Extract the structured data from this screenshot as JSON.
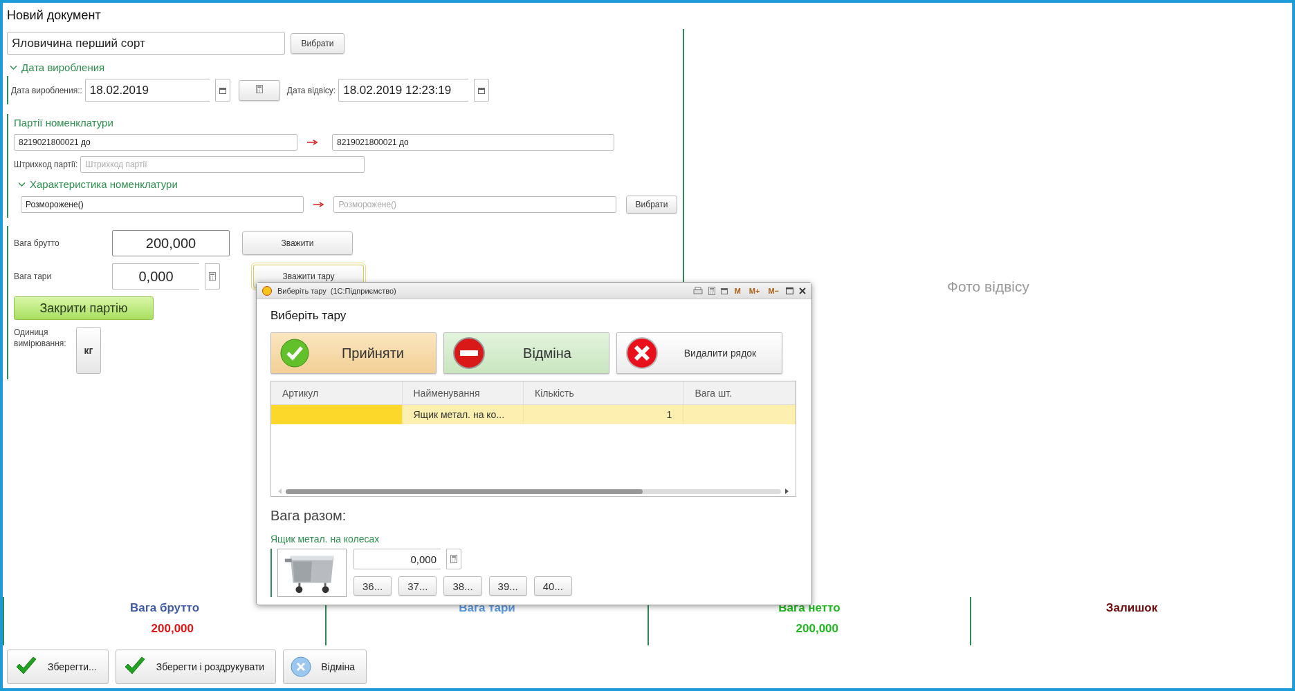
{
  "window": {
    "title": "Новий документ"
  },
  "product": {
    "value": "Яловичина перший сорт",
    "button": "Вибрати"
  },
  "production": {
    "title": "Дата виробления",
    "expanded": true,
    "production_date": {
      "label": "Дата виробления::",
      "value": "18.02.2019"
    },
    "weighing_date": {
      "label": "Дата відвісу:",
      "value": "18.02.2019 12:23:19"
    }
  },
  "batches": {
    "title": "Партії номенклатури",
    "from": "8219021800021 до",
    "to": "8219021800021 до",
    "barcode": {
      "label": "Штрихкод партії:",
      "placeholder": "Штрихкод партії"
    }
  },
  "characteristic": {
    "title": "Характеристика номенклатури",
    "expanded": true,
    "from": "Розморожене()",
    "to_placeholder": "Розморожене()",
    "button": "Вибрати"
  },
  "weights": [
    {
      "label": "Вага брутто",
      "value": "200,000",
      "button": "Зважити",
      "kind": "plain",
      "focused": false
    },
    {
      "label": "Вага тари",
      "value": "0,000",
      "button": "Зважити тару",
      "kind": "calculator",
      "focused": true
    }
  ],
  "close_batch_button": "Закрити партію",
  "unit": {
    "label": "Одиниця вимірювання:",
    "value": "кг"
  },
  "photo": {
    "text": "Фото відвісу"
  },
  "summary": [
    {
      "label": "Вага брутто",
      "color": "#3f5ba8",
      "value": {
        "text": "200,000",
        "color": "#e01515"
      }
    },
    {
      "label": "Вага тари",
      "color": "#5a9ae0"
    },
    {
      "label": "Вага нетто",
      "color": "#20b820",
      "value": {
        "text": "200,000",
        "color": "#20b820"
      }
    },
    {
      "label": "Залишок",
      "color": "#6e0a0a"
    }
  ],
  "actions": [
    {
      "label": "Зберегти...",
      "kind": "check"
    },
    {
      "label": "Зберегти і роздрукувати",
      "kind": "check"
    },
    {
      "label": "Відміна",
      "kind": "cancel"
    }
  ],
  "dialog": {
    "title": "Виберіть тару  (1С:Підприємство)",
    "tools": [
      "M",
      "M+",
      "M−"
    ],
    "heading": "Виберіть тару",
    "buttons": [
      {
        "label": "Прийняти",
        "kind": "accept"
      },
      {
        "label": "Відміна",
        "kind": "cancel"
      },
      {
        "label": "Видалити рядок",
        "kind": "delete"
      }
    ],
    "table": {
      "columns": [
        "Артикул",
        "Найменування",
        "Кількість",
        "Вага шт."
      ],
      "rows": [
        {
          "name": "Ящик метал. на ко...",
          "quantity": "1",
          "selected": true
        }
      ]
    },
    "total_label": "Вага разом:",
    "tare": {
      "name": "Ящик метал. на колесах",
      "value": "0,000",
      "presets": [
        "36...",
        "37...",
        "38...",
        "39...",
        "40..."
      ]
    }
  }
}
